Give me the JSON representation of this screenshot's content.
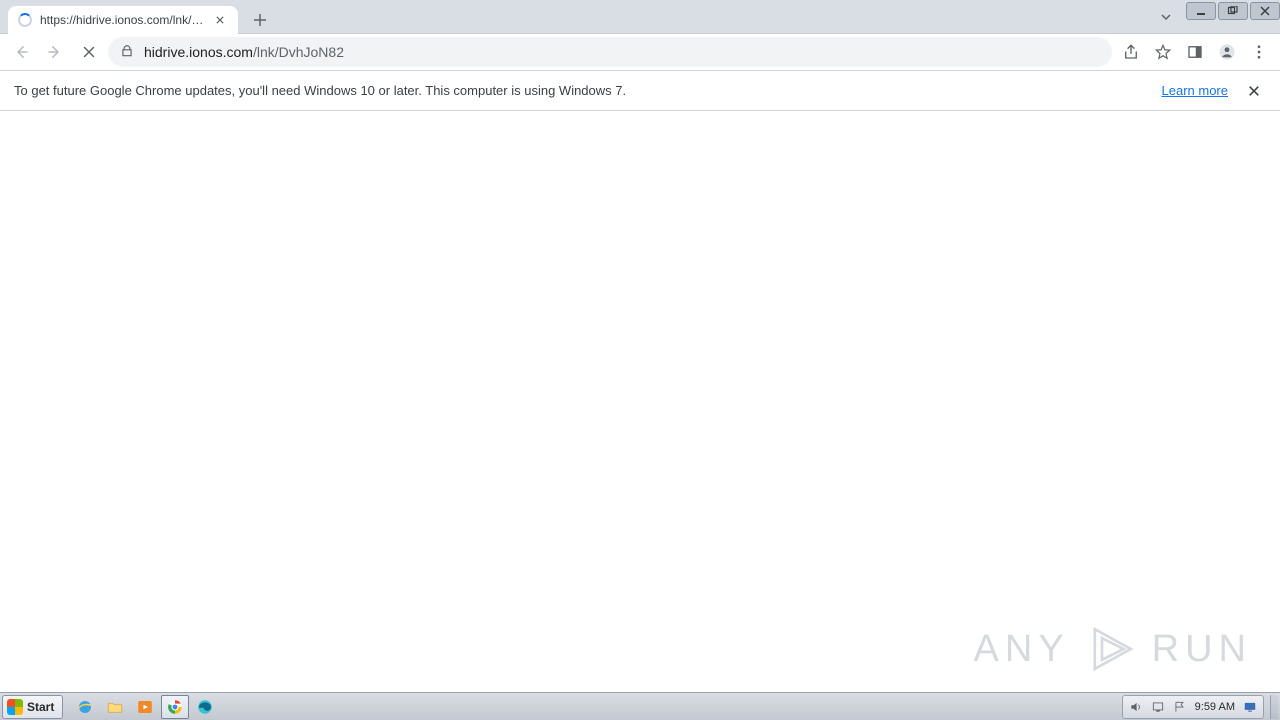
{
  "tab": {
    "title": "https://hidrive.ionos.com/lnk/DvhJoN82"
  },
  "omnibox": {
    "host": "hidrive.ionos.com",
    "path": "/lnk/DvhJoN82"
  },
  "infobar": {
    "message": "To get future Google Chrome updates, you'll need Windows 10 or later. This computer is using Windows 7.",
    "learn_more": "Learn more"
  },
  "watermark": {
    "left": "ANY",
    "right": "RUN"
  },
  "taskbar": {
    "start": "Start",
    "clock": "9:59 AM"
  }
}
